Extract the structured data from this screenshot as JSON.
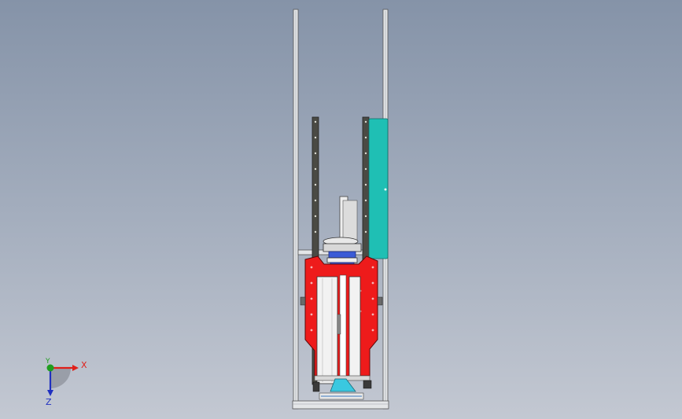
{
  "viewport": {
    "background_top": "#8593a8",
    "background_bottom": "#c3c8d2"
  },
  "model": {
    "frame_color": "#e4e6e8",
    "rail_color": "#4a4a44",
    "cover_color": "#1fbfb4",
    "housing_color": "#ee1b1b",
    "cylinder_color": "#f2f2f2",
    "gear_color": "#3b5bd6",
    "bracket_color": "#3ac8e0"
  },
  "triad": {
    "x_label": "X",
    "y_label": "Y",
    "z_label": "Z",
    "x_color": "#e0201a",
    "y_color": "#1f9e1f",
    "z_color": "#2030c0"
  }
}
